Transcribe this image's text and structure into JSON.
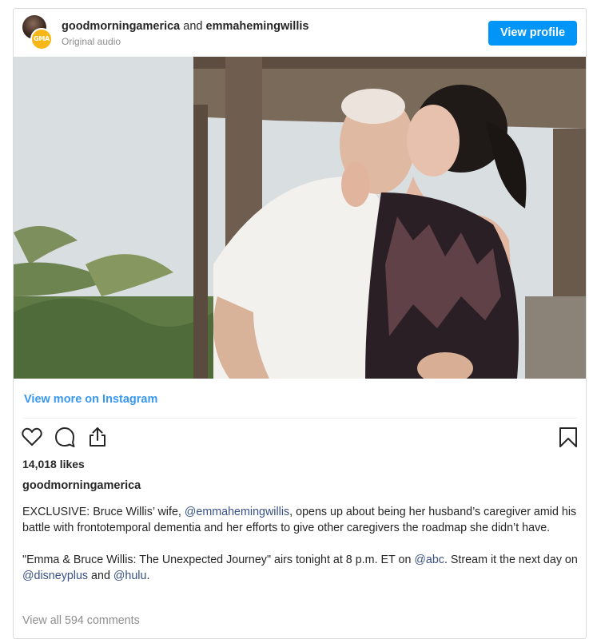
{
  "post": {
    "header": {
      "avatar_badge": "GMA",
      "username_primary": "goodmorningamerica",
      "and_text": "and",
      "username_collab": "emmahemingwillis",
      "subtitle": "Original audio",
      "view_profile_label": "View profile"
    },
    "view_more_label": "View more on Instagram",
    "actions": {
      "like_icon": "heart-icon",
      "comment_icon": "comment-icon",
      "share_icon": "share-icon",
      "save_icon": "bookmark-icon"
    },
    "likes": "14,018 likes",
    "caption_username": "goodmorningamerica",
    "caption": {
      "p1_a": "EXCLUSIVE: Bruce Willis’ wife, ",
      "p1_mention": "@emmahemingwillis",
      "p1_b": ", opens up about being her husband’s caregiver amid his battle with frontotemporal dementia and her efforts to give other caregivers the roadmap she didn’t have.",
      "p2_a": "\"Emma & Bruce Willis: The Unexpected Journey\" airs tonight at 8 p.m. ET on ",
      "p2_mention1": "@abc",
      "p2_b": ". Stream it the next day on ",
      "p2_mention2": "@disneyplus",
      "p2_c": " and ",
      "p2_mention3": "@hulu",
      "p2_d": "."
    },
    "view_comments": "View all 594 comments"
  },
  "colors": {
    "accent": "#0095f6",
    "link": "#3897f0",
    "muted": "#8e8e8e",
    "badge": "#f7b718"
  }
}
